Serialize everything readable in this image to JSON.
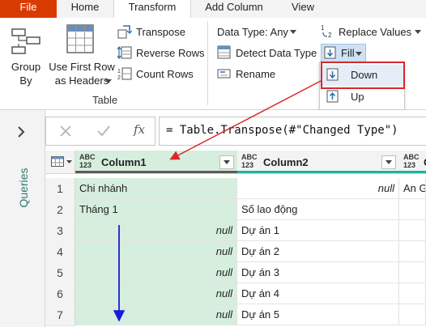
{
  "tabs": [
    {
      "label": "File"
    },
    {
      "label": "Home"
    },
    {
      "label": "Transform"
    },
    {
      "label": "Add Column"
    },
    {
      "label": "View"
    }
  ],
  "ribbon": {
    "group_by": "Group\nBy",
    "use_first_row": "Use First Row\nas Headers",
    "transpose": "Transpose",
    "reverse_rows": "Reverse Rows",
    "count_rows": "Count Rows",
    "table_group": "Table",
    "data_type": "Data Type: Any",
    "detect_data_type": "Detect Data Type",
    "rename": "Rename",
    "replace_values": "Replace Values",
    "fill": "Fill",
    "count_rows_icon_text": "1\n2"
  },
  "fill_menu": {
    "items": [
      {
        "label": "Down"
      },
      {
        "label": "Up"
      }
    ]
  },
  "queries_label": "Queries",
  "formula": {
    "text": "= Table.Transpose(#\"Changed Type\")",
    "fx": "fx"
  },
  "columns": [
    {
      "type": "ABC\n123",
      "name": "Column1"
    },
    {
      "type": "ABC\n123",
      "name": "Column2"
    },
    {
      "type": "ABC\n123",
      "name": "C"
    }
  ],
  "rows": [
    {
      "n": "1",
      "c1": "Chi nhánh",
      "c2": "null",
      "c3": "An G"
    },
    {
      "n": "2",
      "c1": "Tháng 1",
      "c2": "Số lao động",
      "c3": ""
    },
    {
      "n": "3",
      "c1": "null",
      "c2": "Dự án 1",
      "c3": ""
    },
    {
      "n": "4",
      "c1": "null",
      "c2": "Dự án 2",
      "c3": ""
    },
    {
      "n": "5",
      "c1": "null",
      "c2": "Dự án 3",
      "c3": ""
    },
    {
      "n": "6",
      "c1": "null",
      "c2": "Dự án 4",
      "c3": ""
    },
    {
      "n": "7",
      "c1": "null",
      "c2": "Dự án 5",
      "c3": ""
    }
  ],
  "colors": {
    "file_tab": "#d83b01",
    "selected_column": "#d6eedd",
    "teal_bar": "#19b3a6",
    "callout_red": "#d9272e",
    "fill_arrow": "#1a1adb"
  }
}
